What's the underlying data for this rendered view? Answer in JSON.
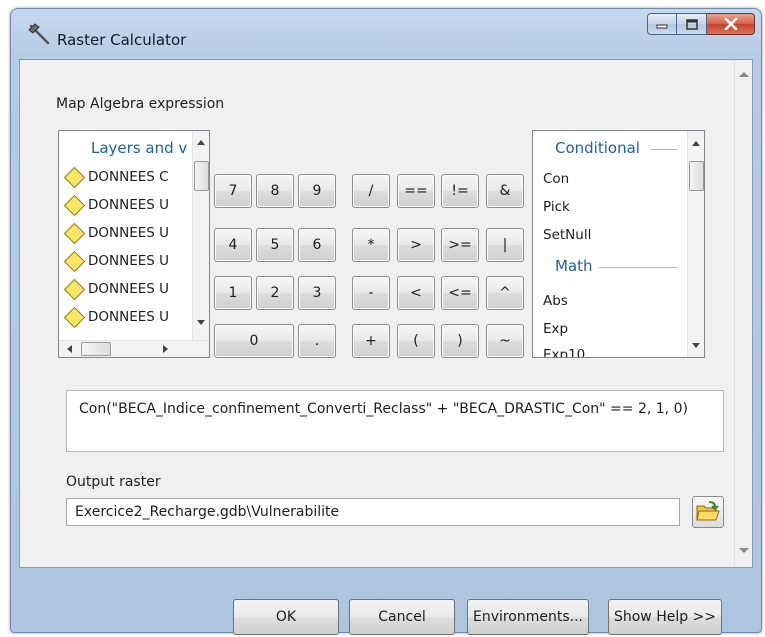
{
  "window": {
    "title": "Raster Calculator"
  },
  "expression_section": {
    "label": "Map Algebra expression"
  },
  "layers_panel": {
    "header": "Layers and v",
    "items": [
      "DONNEES C",
      "DONNEES U",
      "DONNEES U",
      "DONNEES U",
      "DONNEES U",
      "DONNEES U"
    ]
  },
  "keypad": {
    "row1": [
      "7",
      "8",
      "9",
      "/",
      "==",
      "!=",
      "&"
    ],
    "row2": [
      "4",
      "5",
      "6",
      "*",
      ">",
      ">=",
      "|"
    ],
    "row3": [
      "1",
      "2",
      "3",
      "-",
      "<",
      "<=",
      "^"
    ],
    "row4": [
      "0",
      ".",
      "+",
      "(",
      ")",
      "~"
    ]
  },
  "tools_panel": {
    "conditional_header": "Conditional",
    "conditional_items": [
      "Con",
      "Pick",
      "SetNull"
    ],
    "math_header": "Math",
    "math_items": [
      "Abs",
      "Exp",
      "Exp10"
    ]
  },
  "expression": "Con(\"BECA_Indice_confinement_Converti_Reclass\" + \"BECA_DRASTIC_Con\" == 2, 1, 0)",
  "output": {
    "label": "Output raster",
    "value": "Exercice2_Recharge.gdb\\Vulnerabilite"
  },
  "buttons": {
    "ok": "OK",
    "cancel": "Cancel",
    "environments": "Environments...",
    "show_help": "Show Help >>"
  },
  "icons": {
    "app": "hammer-icon",
    "minimize": "minimize-icon",
    "maximize": "maximize-icon",
    "close": "close-icon",
    "browse": "open-folder-icon",
    "layer": "raster-layer-diamond-icon"
  }
}
